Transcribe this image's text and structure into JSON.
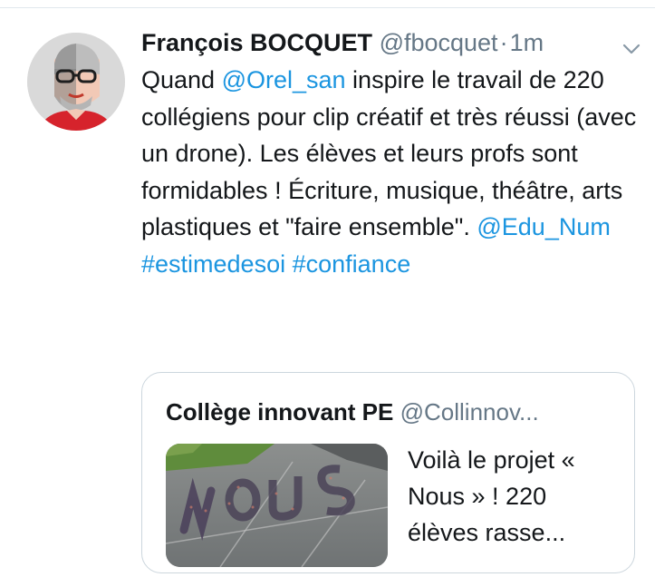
{
  "tweet": {
    "author_name": "François BOCQUET",
    "handle": "@fbocquet",
    "separator": "·",
    "time": "1m",
    "text_parts": [
      {
        "text": "Quand ",
        "link": false
      },
      {
        "text": "@Orel_san",
        "link": true
      },
      {
        "text": " inspire le travail de 220 collégiens pour clip créatif et très réussi (avec un drone). Les élèves et leurs profs sont formidables ! Écriture, musique, théâtre, arts plastiques et \"faire ensemble\". ",
        "link": false
      },
      {
        "text": "@Edu_Num",
        "link": true
      },
      {
        "text": " ",
        "link": false
      },
      {
        "text": "#estimedesoi",
        "link": true
      },
      {
        "text": " ",
        "link": false
      },
      {
        "text": "#confiance",
        "link": true
      }
    ]
  },
  "quoted_tweet": {
    "author_name": "Collège innovant PE",
    "handle": "@Collinnov...",
    "text": "Voilà le projet « Nous » ! 220 élèves rasse..."
  },
  "colors": {
    "link": "#1b95e0",
    "secondary": "#657786",
    "border": "#ccd6dd"
  },
  "icons": {
    "caret": "chevron-down-icon",
    "avatar": "avatar"
  }
}
